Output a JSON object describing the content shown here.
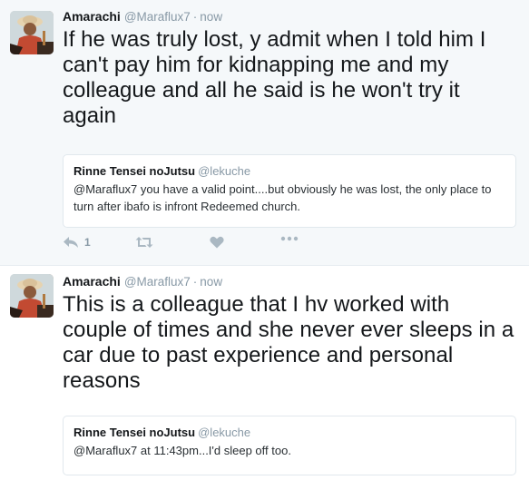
{
  "tweets": [
    {
      "author_name": "Amarachi",
      "author_handle": "@Maraflux7",
      "separator": "·",
      "time": "now",
      "avatar_icon": "user-avatar-photo",
      "text": "If he was truly lost, y admit when I told him I can't pay him for kidnapping me and my colleague and all he said is he won't try it again",
      "quote": {
        "author_name": "Rinne Tensei noJutsu",
        "author_handle": "@lekuche",
        "text": "@Maraflux7 you have a valid point....but obviously he was lost, the only place to turn after ibafo is infront Redeemed church."
      },
      "actions": {
        "reply_icon": "reply-icon",
        "reply_count": "1",
        "retweet_icon": "retweet-icon",
        "like_icon": "heart-icon",
        "more_icon": "more-dots-icon"
      }
    },
    {
      "author_name": "Amarachi",
      "author_handle": "@Maraflux7",
      "separator": "·",
      "time": "now",
      "avatar_icon": "user-avatar-photo",
      "text": "This is a colleague that I hv worked with couple of times and she never ever sleeps in a car due to past experience and personal reasons",
      "quote": {
        "author_name": "Rinne Tensei noJutsu",
        "author_handle": "@lekuche",
        "text": "@Maraflux7 at 11:43pm...I'd sleep off too."
      }
    }
  ],
  "colors": {
    "text_primary": "#14171a",
    "text_secondary": "#8899a6",
    "action_icon": "#aab8c2",
    "tweet_highlight_bg": "#f5f8fa",
    "border": "#e1e8ed"
  }
}
